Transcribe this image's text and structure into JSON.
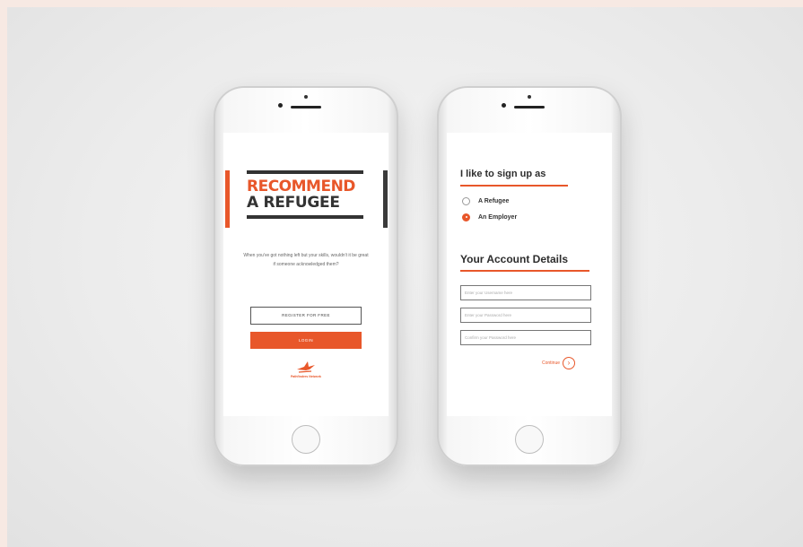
{
  "colors": {
    "accent": "#e8572a",
    "dark": "#333333",
    "background": "#ececec"
  },
  "left_screen": {
    "logo_line1": "RECOMMEND",
    "logo_line2": "A REFUGEE",
    "tagline": "When you've got nothing left but your skills, wouldn't it be great if someone acknowledged them?",
    "register_label": "REGISTER FOR FREE",
    "login_label": "LOGIN",
    "brand_name": "Pathfinders Network"
  },
  "right_screen": {
    "signup_heading": "I like to sign up as",
    "options": [
      {
        "label": "A Refugee",
        "selected": false
      },
      {
        "label": "An Employer",
        "selected": true
      }
    ],
    "account_heading": "Your Account Details",
    "fields": [
      {
        "placeholder": "Enter your Username here"
      },
      {
        "placeholder": "Enter your Password here"
      },
      {
        "placeholder": "Confirm your Password here"
      }
    ],
    "continue_label": "Continue",
    "continue_icon": "chevron-right-icon"
  }
}
